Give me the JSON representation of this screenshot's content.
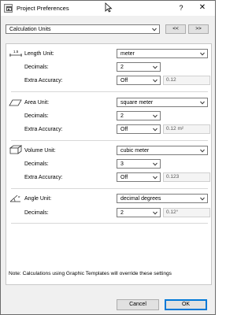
{
  "window": {
    "title": "Project Preferences",
    "help": "?",
    "close": "✕"
  },
  "category": {
    "value": "Calculation Units",
    "prev_label": "<<",
    "next_label": ">>"
  },
  "length": {
    "label": "Length Unit:",
    "unit": "meter",
    "decimals_label": "Decimals:",
    "decimals": "2",
    "extra_label": "Extra Accuracy:",
    "extra": "Off",
    "preview": "0.12"
  },
  "area": {
    "label": "Area Unit:",
    "unit": "square meter",
    "decimals_label": "Decimals:",
    "decimals": "2",
    "extra_label": "Extra Accuracy:",
    "extra": "Off",
    "preview": "0.12 m²"
  },
  "volume": {
    "label": "Volume Unit:",
    "unit": "cubic meter",
    "decimals_label": "Decimals:",
    "decimals": "3",
    "extra_label": "Extra Accuracy:",
    "extra": "Off",
    "preview": "0.123"
  },
  "angle": {
    "label": "Angle Unit:",
    "unit": "decimal degrees",
    "decimals_label": "Decimals:",
    "decimals": "2",
    "preview": "0.12°"
  },
  "note": "Note: Calculations using Graphic Templates will override these settings",
  "buttons": {
    "cancel": "Cancel",
    "ok": "OK"
  },
  "colors": {
    "ok_border": "#0078d7",
    "window_bg": "#f0f0f0"
  }
}
